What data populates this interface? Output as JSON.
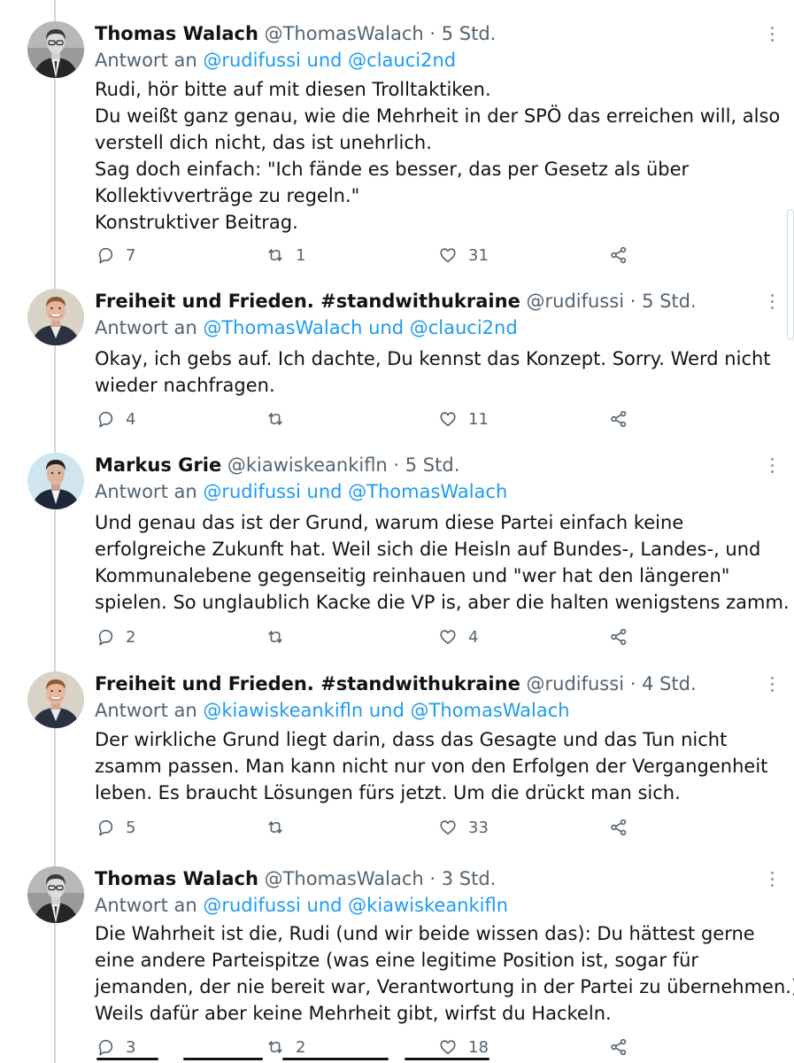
{
  "tweets": [
    {
      "name": "Thomas Walach",
      "handle": "@ThomasWalach",
      "time": "· 5 Std.",
      "reply_prefix": "Antwort an",
      "reply_mentions": "@rudifussi und @clauci2nd",
      "lines": [
        "Rudi, hör bitte auf mit diesen Trolltaktiken.",
        "Du weißt ganz genau, wie die Mehrheit in der SPÖ das erreichen will, also",
        "verstell dich nicht, das ist unehrlich.",
        "Sag doch einfach: \"Ich fände es besser, das per Gesetz als über",
        "Kollektivverträge zu regeln.\"",
        "Konstruktiver Beitrag."
      ],
      "replies": "7",
      "retweets": "1",
      "likes": "31"
    },
    {
      "name": "Freiheit und Frieden. #standwithukraine",
      "handle": "@rudifussi",
      "time": "· 5 Std.",
      "reply_prefix": "Antwort an",
      "reply_mentions": "@ThomasWalach und @clauci2nd",
      "lines": [
        "Okay,  ich gebs auf. Ich dachte,  Du kennst das Konzept. Sorry. Werd nicht",
        "wieder nachfragen."
      ],
      "replies": "4",
      "retweets": "",
      "likes": "11"
    },
    {
      "name": "Markus Grie",
      "handle": "@kiawiskeankifln",
      "time": "· 5 Std.",
      "reply_prefix": "Antwort an",
      "reply_mentions": "@rudifussi und @ThomasWalach",
      "lines": [
        "Und genau das ist der Grund, warum diese Partei einfach keine",
        "erfolgreiche Zukunft hat. Weil sich die Heisln auf Bundes-, Landes-, und",
        "Kommunalebene gegenseitig reinhauen und \"wer hat den längeren\"",
        "spielen. So unglaublich Kacke die VP is, aber die halten wenigstens zamm."
      ],
      "replies": "2",
      "retweets": "",
      "likes": "4"
    },
    {
      "name": "Freiheit und Frieden. #standwithukraine",
      "handle": "@rudifussi",
      "time": "· 4 Std.",
      "reply_prefix": "Antwort an",
      "reply_mentions": "@kiawiskeankifln und @ThomasWalach",
      "lines": [
        "Der wirkliche Grund liegt darin,  dass das Gesagte und das Tun nicht",
        "zsamm passen. Man kann nicht nur von den Erfolgen der Vergangenheit",
        "leben. Es braucht Lösungen fürs jetzt. Um die drückt man sich."
      ],
      "replies": "5",
      "retweets": "",
      "likes": "33"
    },
    {
      "name": "Thomas Walach",
      "handle": "@ThomasWalach",
      "time": "· 3 Std.",
      "reply_prefix": "Antwort an",
      "reply_mentions": "@rudifussi und @kiawiskeankifln",
      "lines": [
        "Die Wahrheit ist die, Rudi (und wir beide wissen das): Du hättest gerne",
        "eine andere Parteispitze (was eine legitime Position ist, sogar für",
        "jemanden, der nie bereit war, Verantwortung in der Partei zu übernehmen.)",
        "Weils dafür aber keine Mehrheit gibt, wirfst du Hackeln."
      ],
      "replies": "3",
      "retweets": "2",
      "likes": "18"
    }
  ],
  "icons": {
    "reply": "reply-icon",
    "retweet": "retweet-icon",
    "like": "heart-icon",
    "share": "share-icon",
    "more": "more-icon"
  },
  "colors": {
    "text": "#0f1419",
    "muted": "#536471",
    "link": "#1d9bf0",
    "thread_line": "#cfd9de"
  }
}
